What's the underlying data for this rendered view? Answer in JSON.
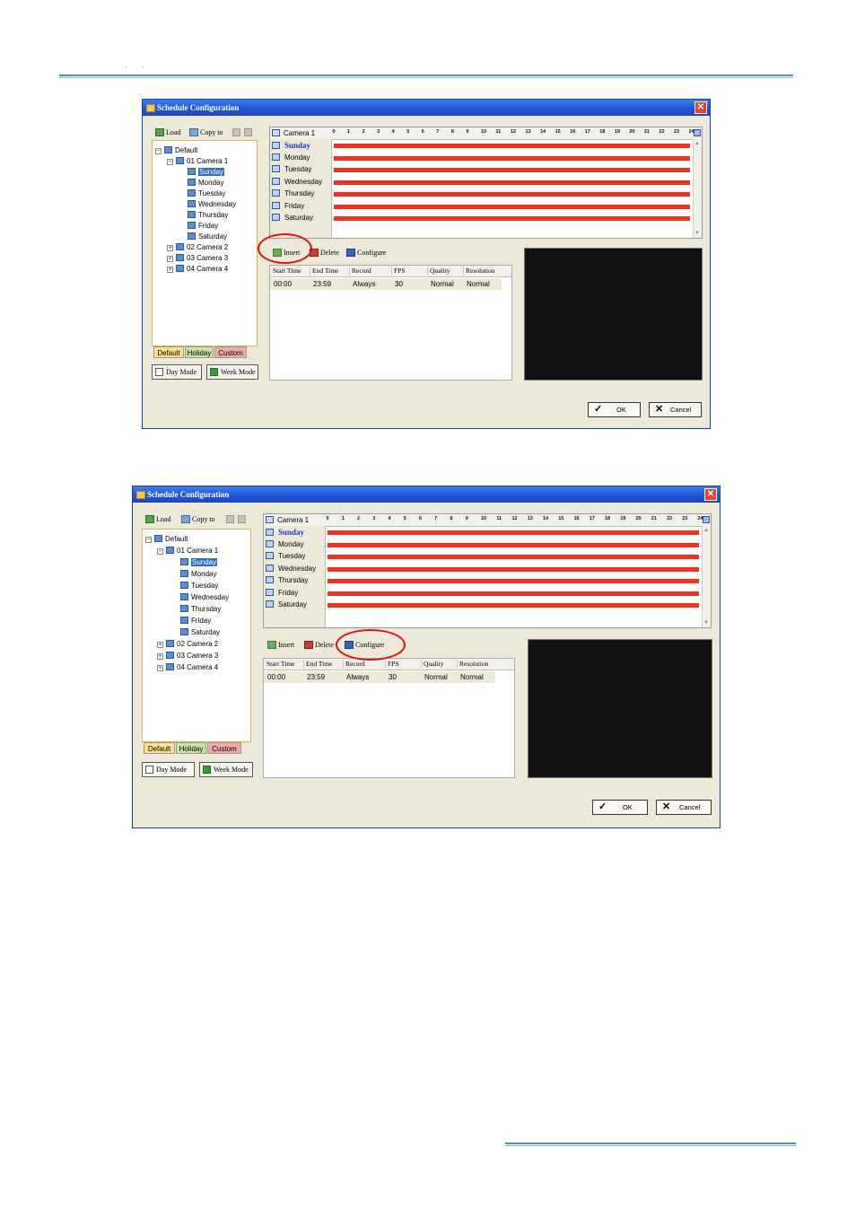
{
  "dialogs": [
    {
      "title": "Schedule Configuration",
      "close_glyph": "✕",
      "toolbar": {
        "load": "Load",
        "copy_to": "Copy to"
      },
      "tree": {
        "root": "Default",
        "camera": "01 Camera 1",
        "days": [
          "Sunday",
          "Monday",
          "Tuesday",
          "Wednesday",
          "Thursday",
          "Friday",
          "Saturday"
        ],
        "other_cameras": [
          "02 Camera 2",
          "03 Camera 3",
          "04 Camera 4"
        ],
        "plus": "+",
        "minus": "−"
      },
      "tabs": {
        "default": "Default",
        "holiday": "Holiday",
        "custom": "Custom"
      },
      "modes": {
        "day": "Day Mode",
        "week": "Week Mode"
      },
      "schedule": {
        "camera_label": "Camera 1",
        "hours": [
          "0",
          "1",
          "2",
          "3",
          "4",
          "5",
          "6",
          "7",
          "8",
          "9",
          "10",
          "11",
          "12",
          "13",
          "14",
          "15",
          "16",
          "17",
          "18",
          "19",
          "20",
          "21",
          "22",
          "23",
          "24"
        ],
        "days": [
          "Sunday",
          "Monday",
          "Tuesday",
          "Wednesday",
          "Thursday",
          "Friday",
          "Saturday"
        ],
        "active_day": "Sunday",
        "bar_color": "#ee3322",
        "bar_start_hour": 0,
        "bar_end_hour": 24
      },
      "actions": {
        "insert": "Insert",
        "delete": "Delete",
        "configure": "Configure"
      },
      "table": {
        "columns": [
          "Start Time",
          "End Time",
          "Record",
          "FPS",
          "Quality",
          "Resolution"
        ],
        "rows": [
          [
            "00:00",
            "23:59",
            "Always",
            "30",
            "Normal",
            "Normal"
          ]
        ]
      },
      "buttons": {
        "ok": "OK",
        "cancel": "Cancel"
      },
      "highlight": "insert"
    },
    {
      "title": "Schedule Configuration",
      "close_glyph": "✕",
      "toolbar": {
        "load": "Load",
        "copy_to": "Copy to"
      },
      "tree": {
        "root": "Default",
        "camera": "01 Camera 1",
        "days": [
          "Sunday",
          "Monday",
          "Tuesday",
          "Wednesday",
          "Thursday",
          "Friday",
          "Saturday"
        ],
        "other_cameras": [
          "02 Camera 2",
          "03 Camera 3",
          "04 Camera 4"
        ],
        "plus": "+",
        "minus": "−"
      },
      "tabs": {
        "default": "Default",
        "holiday": "Holiday",
        "custom": "Custom"
      },
      "modes": {
        "day": "Day Mode",
        "week": "Week Mode"
      },
      "schedule": {
        "camera_label": "Camera 1",
        "hours": [
          "0",
          "1",
          "2",
          "3",
          "4",
          "5",
          "6",
          "7",
          "8",
          "9",
          "10",
          "11",
          "12",
          "13",
          "14",
          "15",
          "16",
          "17",
          "18",
          "19",
          "20",
          "21",
          "22",
          "23",
          "24"
        ],
        "days": [
          "Sunday",
          "Monday",
          "Tuesday",
          "Wednesday",
          "Thursday",
          "Friday",
          "Saturday"
        ],
        "active_day": "Sunday",
        "bar_color": "#ee3322",
        "bar_start_hour": 0,
        "bar_end_hour": 24
      },
      "actions": {
        "insert": "Insert",
        "delete": "Delete",
        "configure": "Configure"
      },
      "table": {
        "columns": [
          "Start Time",
          "End Time",
          "Record",
          "FPS",
          "Quality",
          "Resolution"
        ],
        "rows": [
          [
            "00:00",
            "23:59",
            "Always",
            "30",
            "Normal",
            "Normal"
          ]
        ]
      },
      "buttons": {
        "ok": "OK",
        "cancel": "Cancel"
      },
      "highlight": "configure"
    }
  ],
  "colors": {
    "accent_rule": "#4a8fd0",
    "titlebar": "#1f55d6",
    "highlight_circle": "#e01010"
  }
}
